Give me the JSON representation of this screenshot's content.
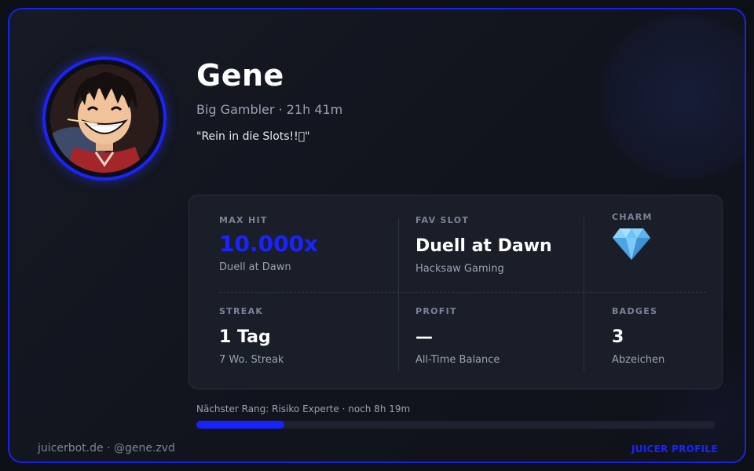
{
  "profile": {
    "name": "Gene",
    "subtitle": "Big Gambler · 21h 41m",
    "quote": "\"Rein in die Slots!!⃞\""
  },
  "stats": {
    "max_hit": {
      "label": "MAX HIT",
      "value": "10.000x",
      "sub": "Duell at Dawn"
    },
    "fav_slot": {
      "label": "FAV SLOT",
      "value": "Duell at Dawn",
      "sub": "Hacksaw Gaming"
    },
    "charm": {
      "label": "CHARM",
      "icon": "diamond-icon"
    },
    "streak": {
      "label": "STREAK",
      "value": "1 Tag",
      "sub": "7 Wo. Streak"
    },
    "profit": {
      "label": "PROFIT",
      "value": "—",
      "sub": "All-Time Balance"
    },
    "badges": {
      "label": "BADGES",
      "value": "3",
      "sub": "Abzeichen"
    }
  },
  "progress": {
    "label": "Nächster Rang: Risiko Experte · noch 8h 19m",
    "fraction": 0.17
  },
  "footer": {
    "left": "juicerbot.de · @gene.zvd",
    "right": "JUICER PROFILE"
  },
  "colors": {
    "accent": "#1a22ff",
    "background": "#11141d",
    "panel": "#1a1e29"
  }
}
